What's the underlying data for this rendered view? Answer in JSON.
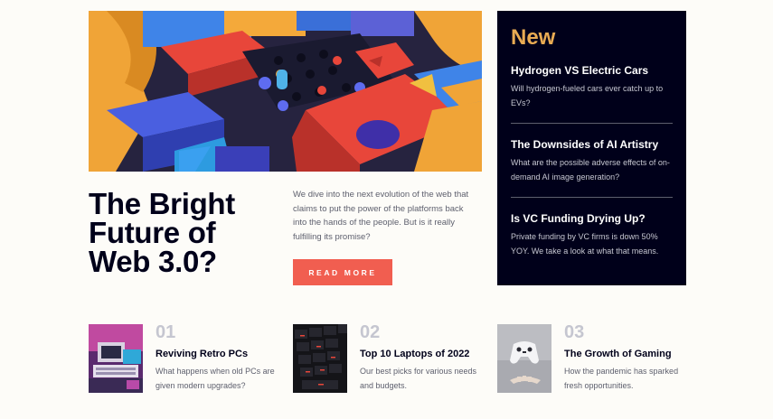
{
  "hero": {
    "image_icon": "abstract-3d-blocks-image",
    "title_line1": "The Bright",
    "title_line2": "Future of",
    "title_line3": "Web 3.0?",
    "description": "We dive into the next evolution of the web that claims to put the power of the platforms back into the hands of the people. But is it really fulfilling its promise?",
    "button_label": "READ MORE"
  },
  "new_panel": {
    "heading": "New",
    "items": [
      {
        "title": "Hydrogen VS Electric Cars",
        "description": "Will hydrogen-fueled cars ever catch up to EVs?"
      },
      {
        "title": "The Downsides of AI Artistry",
        "description": "What are the possible adverse effects of on-demand AI image generation?"
      },
      {
        "title": "Is VC Funding Drying Up?",
        "description": "Private funding by VC firms is down 50% YOY. We take a look at what that means."
      }
    ]
  },
  "list": [
    {
      "number": "01",
      "title": "Reviving Retro PCs",
      "description": "What happens when old PCs are given modern upgrades?",
      "image_icon": "retro-pc-image"
    },
    {
      "number": "02",
      "title": "Top 10 Laptops of 2022",
      "description": "Our best picks for various needs and budgets.",
      "image_icon": "laptop-keyboard-image"
    },
    {
      "number": "03",
      "title": "The Growth of Gaming",
      "description": "How the pandemic has sparked fresh opportunities.",
      "image_icon": "game-controller-image"
    }
  ],
  "colors": {
    "background": "#fdfcf8",
    "dark_navy": "#00001a",
    "accent_orange": "#e9ab53",
    "accent_red": "#f15e50",
    "grey_blue": "#5d5f6d",
    "light_grey": "#c5c6d0"
  }
}
